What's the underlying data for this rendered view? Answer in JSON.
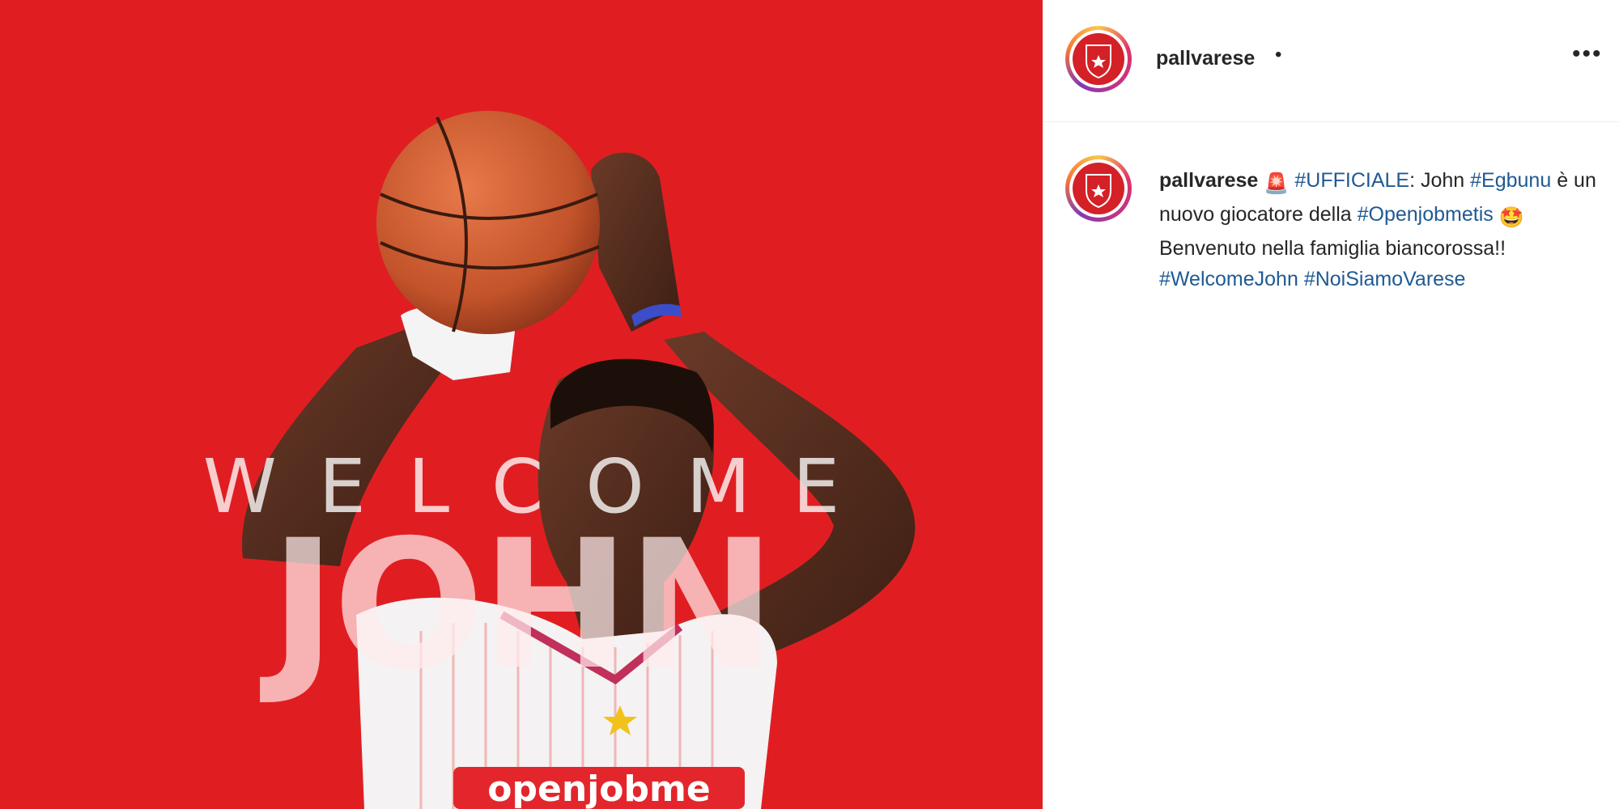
{
  "post": {
    "overlay_welcome": "WELCOME",
    "overlay_name": "JOHN",
    "jersey_text": "openjobme"
  },
  "header": {
    "username": "pallvarese",
    "dot": "•",
    "more": "•••"
  },
  "caption": {
    "username": "pallvarese",
    "siren_emoji": "🚨",
    "hashtag_ufficiale": "#UFFICIALE",
    "text_1": ": John",
    "hashtag_egbunu": "#Egbunu",
    "text_2": " è un nuovo giocatore della",
    "hashtag_openjobmetis": "#Openjobmetis",
    "star_eyes_emoji": "🤩",
    "text_3": " Benvenuto nella famiglia biancorossa!! ",
    "hashtag_welcomejohn": "#WelcomeJohn",
    "hashtag_noisiamovarese": "#NoiSiamoVarese"
  },
  "colors": {
    "brand_red": "#e01e22",
    "hashtag_blue": "#1f5a93",
    "text_dark": "#262626"
  },
  "icons": [
    "pallvarese-logo-icon",
    "more-options-icon"
  ]
}
